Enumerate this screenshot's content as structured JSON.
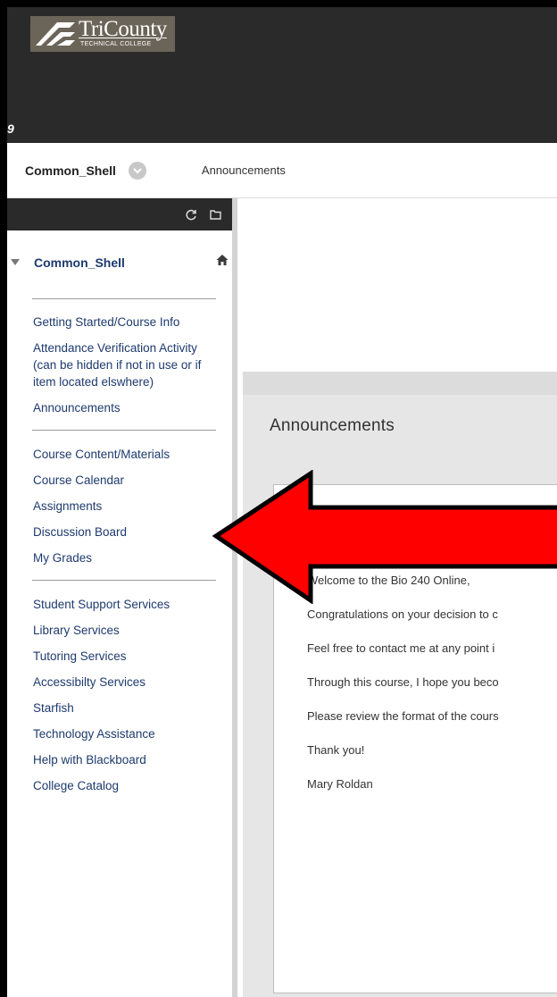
{
  "header": {
    "logo_title": "TriCounty",
    "logo_subtitle": "TECHNICAL COLLEGE",
    "corner_glyph": "9"
  },
  "breadcrumb": {
    "course": "Common_Shell",
    "page": "Announcements"
  },
  "sidebar": {
    "title": "Common_Shell",
    "groups": [
      [
        "Getting Started/Course Info",
        "Attendance Verification Activity (can be hidden if not in use or if item located elswhere)",
        "Announcements"
      ],
      [
        "Course Content/Materials",
        "Course Calendar",
        "Assignments",
        "Discussion Board",
        "My Grades"
      ],
      [
        "Student Support Services",
        "Library Services",
        "Tutoring Services",
        "Accessibilty Services",
        "Starfish",
        "Technology Assistance",
        "Help with Blackboard",
        "College Catalog"
      ]
    ]
  },
  "main": {
    "heading": "Announcements",
    "lines": [
      "Welcome to the Bio 240 Online,",
      "Congratulations on your decision to c",
      "Feel free to contact me at any point i",
      "Through this course, I hope you beco",
      "Please review the format of the cours",
      "Thank you!",
      "Mary Roldan"
    ]
  },
  "colors": {
    "link": "#1e3a6e",
    "header_bg": "#2a2a2a",
    "arrow": "#ff0000"
  }
}
